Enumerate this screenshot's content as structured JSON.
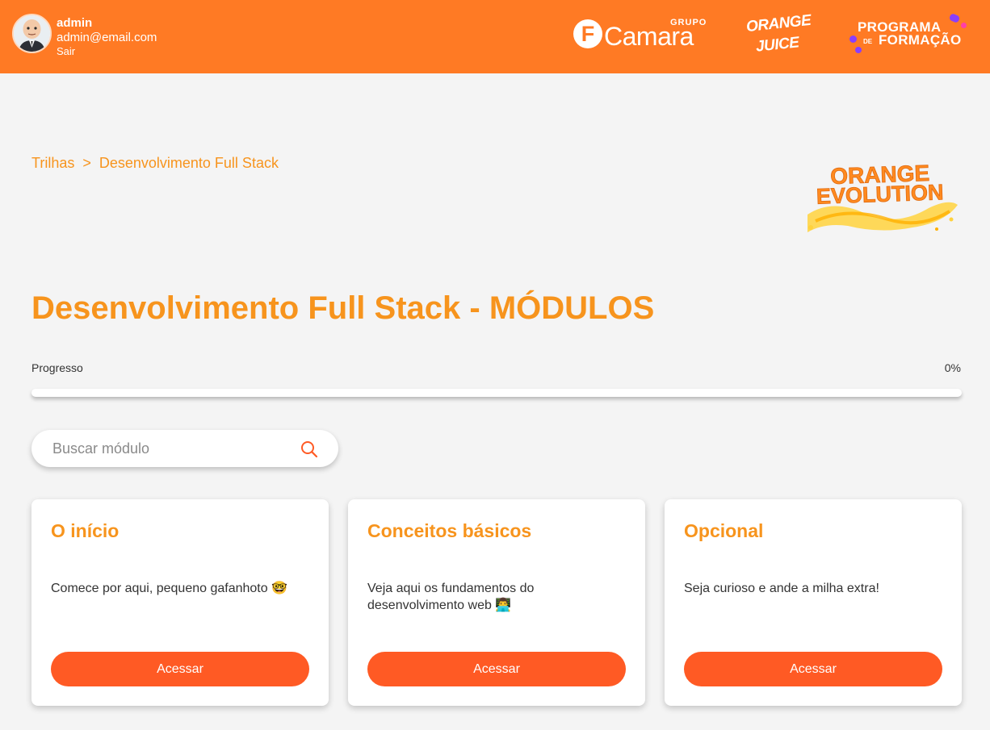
{
  "user": {
    "name": "admin",
    "email": "admin@email.com",
    "logout_label": "Sair"
  },
  "header_logos": {
    "camara_letter": "F",
    "camara_grupo": "GRUPO",
    "camara_word": "Camara",
    "orange_juice_line1": "ORANGE",
    "orange_juice_line2": "JUICE",
    "programa_line1": "PROGRAMA",
    "programa_de": "DE",
    "programa_line2": "FORMAÇÃO",
    "orange_evolution_line1": "ORANGE",
    "orange_evolution_line2": "EVOLUTION"
  },
  "breadcrumb": {
    "items": [
      "Trilhas",
      "Desenvolvimento Full Stack"
    ],
    "separator": ">"
  },
  "page_title": "Desenvolvimento Full Stack - MÓDULOS",
  "progress": {
    "label": "Progresso",
    "value_text": "0%",
    "value": 0
  },
  "search": {
    "placeholder": "Buscar módulo",
    "value": ""
  },
  "modules": [
    {
      "title": "O início",
      "description": "Comece por aqui, pequeno gafanhoto 🤓",
      "button": "Acessar"
    },
    {
      "title": "Conceitos básicos",
      "description": "Veja aqui os fundamentos do desenvolvimento web 👨‍💻",
      "button": "Acessar"
    },
    {
      "title": "Opcional",
      "description": "Seja curioso e ande a milha extra!",
      "button": "Acessar"
    }
  ],
  "colors": {
    "header_bg": "#ff7a24",
    "accent_text": "#f7941d",
    "button_bg": "#ff5a24",
    "page_bg": "#f4f4f4"
  }
}
